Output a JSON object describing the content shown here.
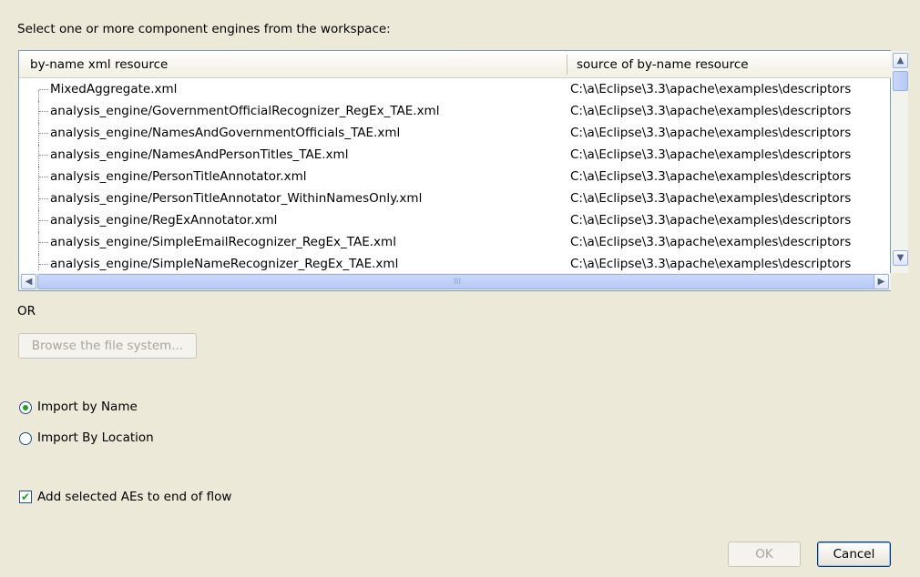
{
  "instruction": "Select one or more component engines from the workspace:",
  "table": {
    "columns": [
      "by-name xml resource",
      "source of by-name resource"
    ],
    "rows": [
      {
        "name": "MixedAggregate.xml",
        "source": "C:\\a\\Eclipse\\3.3\\apache\\examples\\descriptors"
      },
      {
        "name": "analysis_engine/GovernmentOfficialRecognizer_RegEx_TAE.xml",
        "source": "C:\\a\\Eclipse\\3.3\\apache\\examples\\descriptors"
      },
      {
        "name": "analysis_engine/NamesAndGovernmentOfficials_TAE.xml",
        "source": "C:\\a\\Eclipse\\3.3\\apache\\examples\\descriptors"
      },
      {
        "name": "analysis_engine/NamesAndPersonTitles_TAE.xml",
        "source": "C:\\a\\Eclipse\\3.3\\apache\\examples\\descriptors"
      },
      {
        "name": "analysis_engine/PersonTitleAnnotator.xml",
        "source": "C:\\a\\Eclipse\\3.3\\apache\\examples\\descriptors"
      },
      {
        "name": "analysis_engine/PersonTitleAnnotator_WithinNamesOnly.xml",
        "source": "C:\\a\\Eclipse\\3.3\\apache\\examples\\descriptors"
      },
      {
        "name": "analysis_engine/RegExAnnotator.xml",
        "source": "C:\\a\\Eclipse\\3.3\\apache\\examples\\descriptors"
      },
      {
        "name": "analysis_engine/SimpleEmailRecognizer_RegEx_TAE.xml",
        "source": "C:\\a\\Eclipse\\3.3\\apache\\examples\\descriptors"
      },
      {
        "name": "analysis_engine/SimpleNameRecognizer_RegEx_TAE.xml",
        "source": "C:\\a\\Eclipse\\3.3\\apache\\examples\\descriptors"
      }
    ]
  },
  "or_label": "OR",
  "browse_button": "Browse the file system...",
  "import_options": {
    "by_name": "Import by Name",
    "by_location": "Import By Location",
    "selected": "by_name"
  },
  "add_to_flow": {
    "label": "Add selected AEs to end of flow",
    "checked": true
  },
  "buttons": {
    "ok": "OK",
    "cancel": "Cancel"
  },
  "scroll_glyphs": {
    "up": "▲",
    "down": "▼",
    "left": "◀",
    "right": "▶",
    "grip": "III"
  },
  "check_glyph": "✔",
  "icons": [
    "tree-connector",
    "radio-selected",
    "checkbox-checked",
    "scroll-arrow-icons"
  ]
}
